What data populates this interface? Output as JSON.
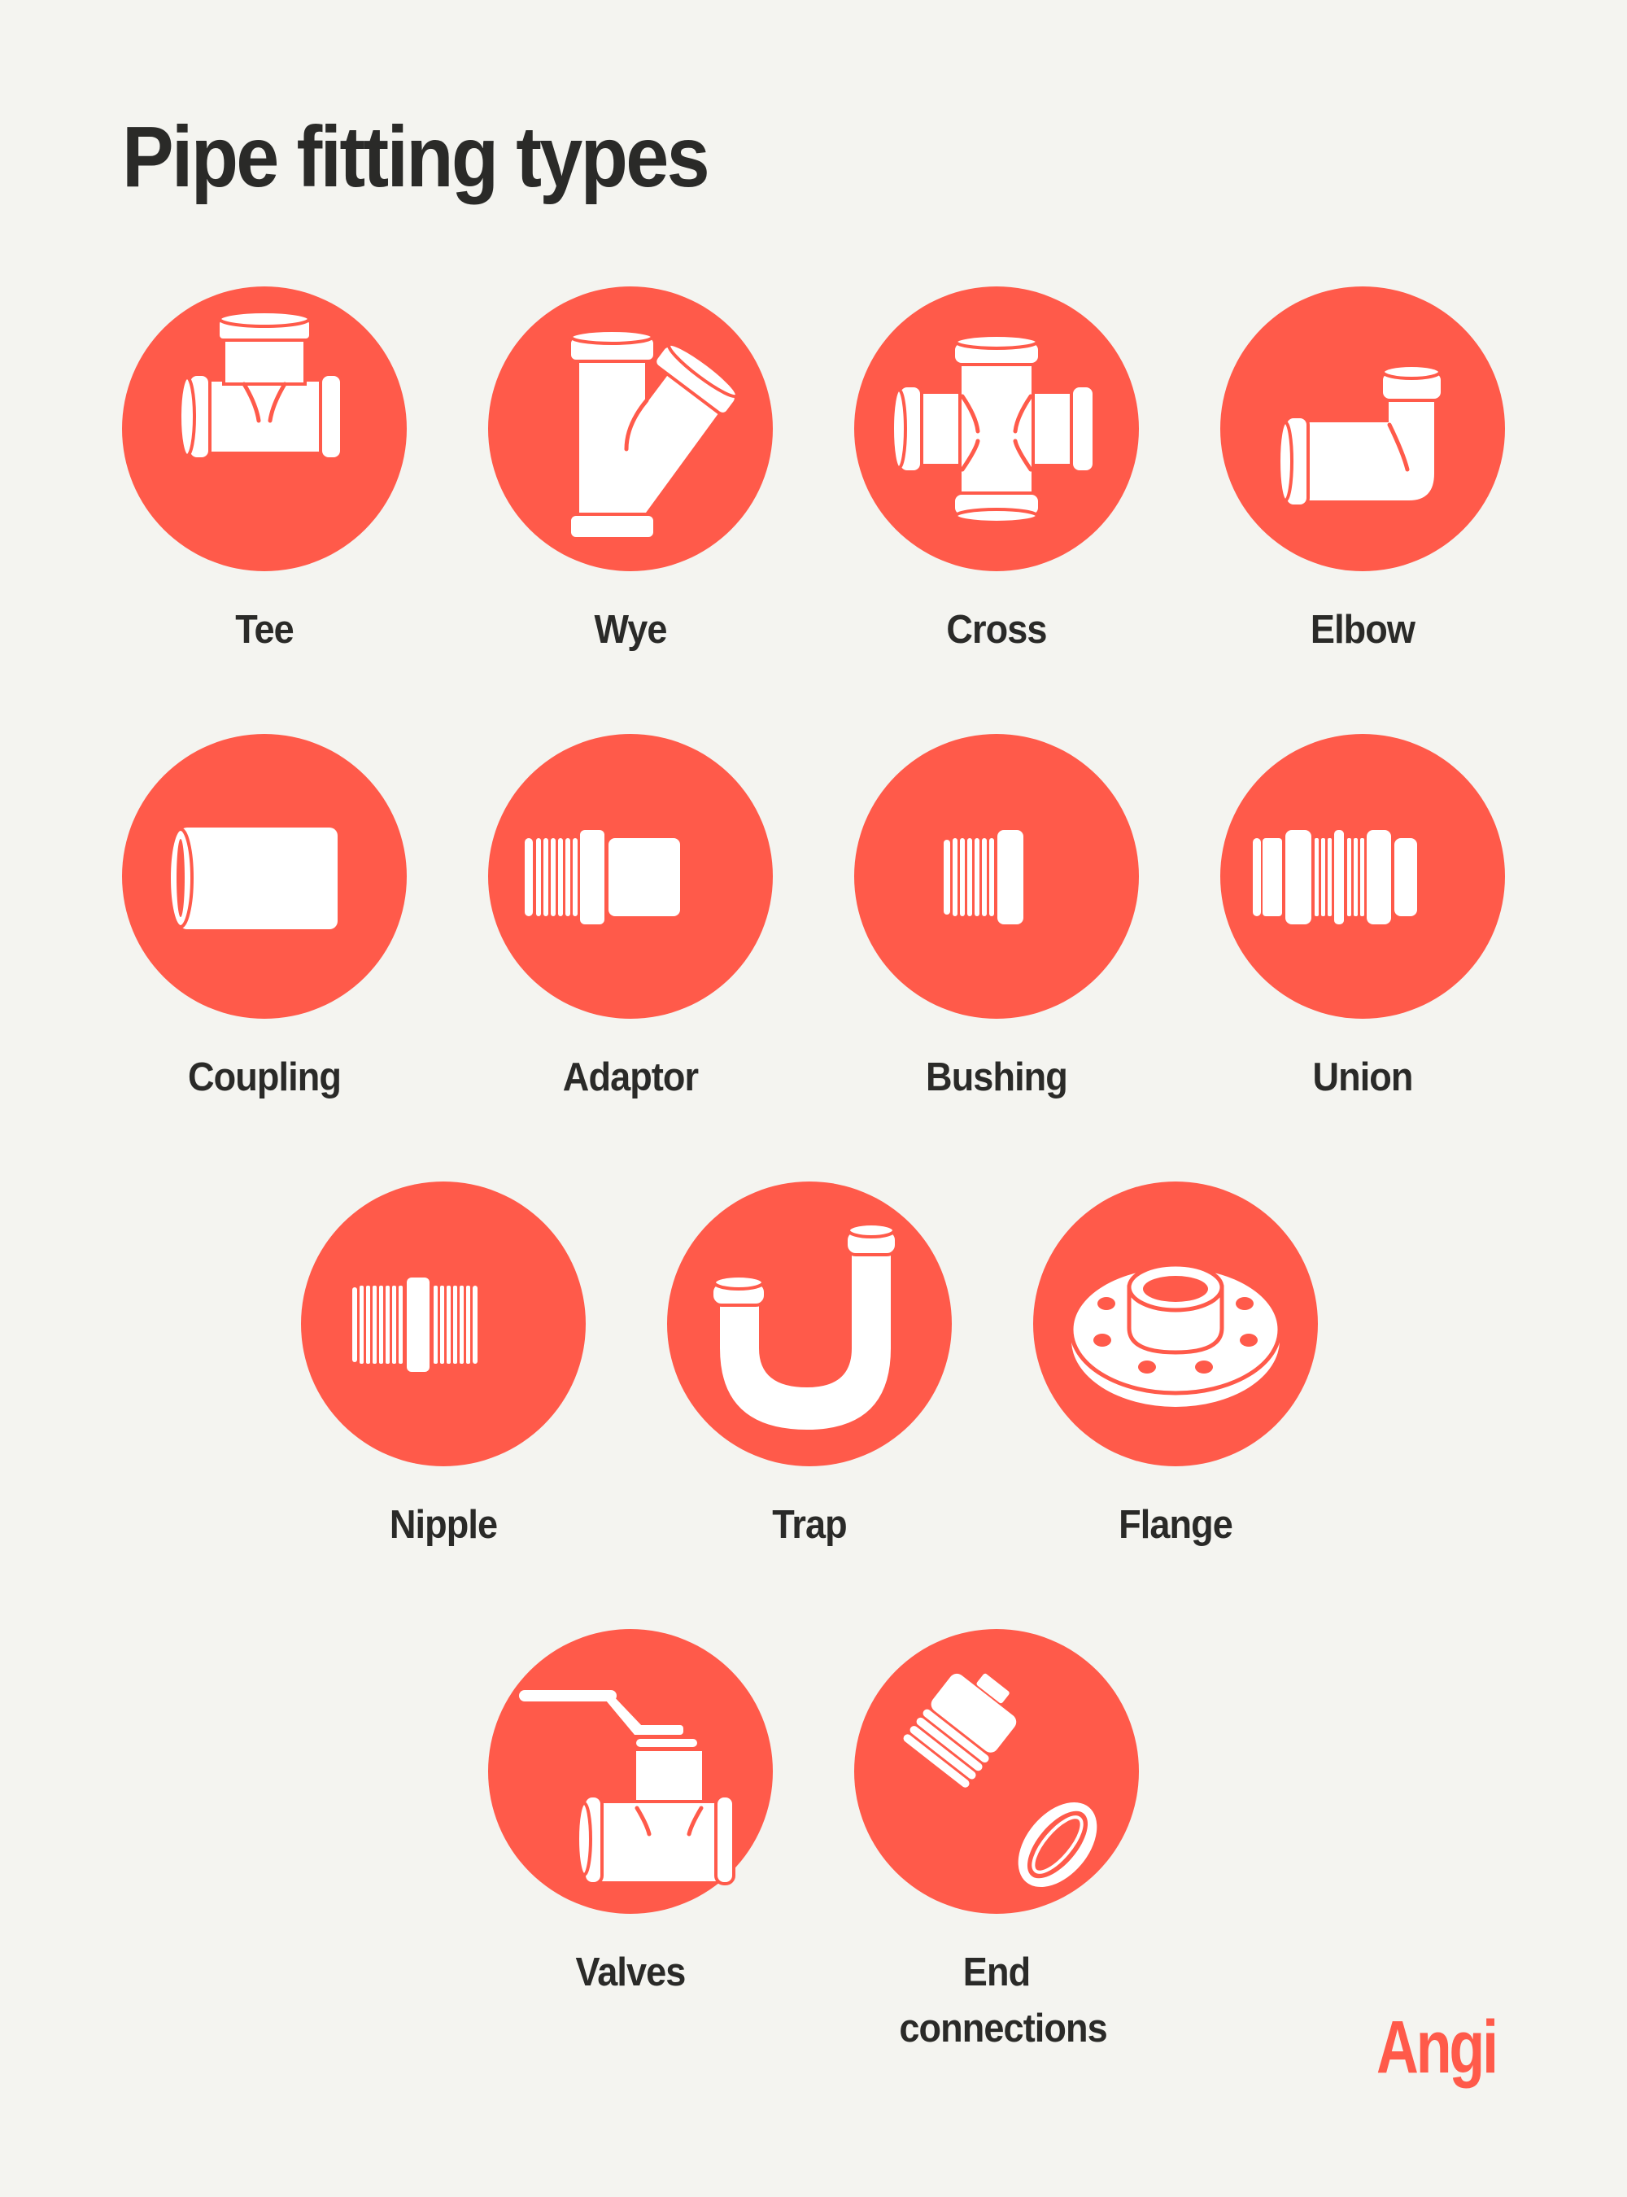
{
  "title": "Pipe fitting types",
  "colors": {
    "accent": "#FF5A4A",
    "background": "#F4F4F0",
    "text": "#2A2A28",
    "icon": "#FFFFFF"
  },
  "fittings": [
    {
      "label": "Tee",
      "icon": "tee-icon"
    },
    {
      "label": "Wye",
      "icon": "wye-icon"
    },
    {
      "label": "Cross",
      "icon": "cross-icon"
    },
    {
      "label": "Elbow",
      "icon": "elbow-icon"
    },
    {
      "label": "Coupling",
      "icon": "coupling-icon"
    },
    {
      "label": "Adaptor",
      "icon": "adaptor-icon"
    },
    {
      "label": "Bushing",
      "icon": "bushing-icon"
    },
    {
      "label": "Union",
      "icon": "union-icon"
    },
    {
      "label": "Nipple",
      "icon": "nipple-icon"
    },
    {
      "label": "Trap",
      "icon": "trap-icon"
    },
    {
      "label": "Flange",
      "icon": "flange-icon"
    },
    {
      "label": "Valves",
      "icon": "valve-icon"
    },
    {
      "label": "End connections",
      "icon": "end-connections-icon"
    }
  ],
  "brand": {
    "logo_text": "Angi"
  }
}
